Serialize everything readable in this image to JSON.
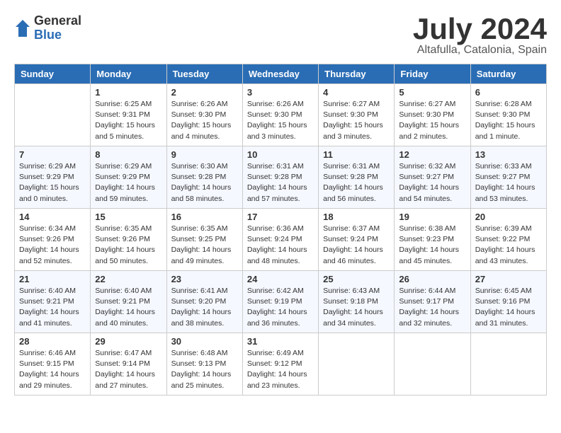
{
  "logo": {
    "general": "General",
    "blue": "Blue"
  },
  "header": {
    "month": "July 2024",
    "location": "Altafulla, Catalonia, Spain"
  },
  "weekdays": [
    "Sunday",
    "Monday",
    "Tuesday",
    "Wednesday",
    "Thursday",
    "Friday",
    "Saturday"
  ],
  "weeks": [
    [
      {
        "day": "",
        "sunrise": "",
        "sunset": "",
        "daylight": ""
      },
      {
        "day": "1",
        "sunrise": "Sunrise: 6:25 AM",
        "sunset": "Sunset: 9:31 PM",
        "daylight": "Daylight: 15 hours and 5 minutes."
      },
      {
        "day": "2",
        "sunrise": "Sunrise: 6:26 AM",
        "sunset": "Sunset: 9:30 PM",
        "daylight": "Daylight: 15 hours and 4 minutes."
      },
      {
        "day": "3",
        "sunrise": "Sunrise: 6:26 AM",
        "sunset": "Sunset: 9:30 PM",
        "daylight": "Daylight: 15 hours and 3 minutes."
      },
      {
        "day": "4",
        "sunrise": "Sunrise: 6:27 AM",
        "sunset": "Sunset: 9:30 PM",
        "daylight": "Daylight: 15 hours and 3 minutes."
      },
      {
        "day": "5",
        "sunrise": "Sunrise: 6:27 AM",
        "sunset": "Sunset: 9:30 PM",
        "daylight": "Daylight: 15 hours and 2 minutes."
      },
      {
        "day": "6",
        "sunrise": "Sunrise: 6:28 AM",
        "sunset": "Sunset: 9:30 PM",
        "daylight": "Daylight: 15 hours and 1 minute."
      }
    ],
    [
      {
        "day": "7",
        "sunrise": "Sunrise: 6:29 AM",
        "sunset": "Sunset: 9:29 PM",
        "daylight": "Daylight: 15 hours and 0 minutes."
      },
      {
        "day": "8",
        "sunrise": "Sunrise: 6:29 AM",
        "sunset": "Sunset: 9:29 PM",
        "daylight": "Daylight: 14 hours and 59 minutes."
      },
      {
        "day": "9",
        "sunrise": "Sunrise: 6:30 AM",
        "sunset": "Sunset: 9:28 PM",
        "daylight": "Daylight: 14 hours and 58 minutes."
      },
      {
        "day": "10",
        "sunrise": "Sunrise: 6:31 AM",
        "sunset": "Sunset: 9:28 PM",
        "daylight": "Daylight: 14 hours and 57 minutes."
      },
      {
        "day": "11",
        "sunrise": "Sunrise: 6:31 AM",
        "sunset": "Sunset: 9:28 PM",
        "daylight": "Daylight: 14 hours and 56 minutes."
      },
      {
        "day": "12",
        "sunrise": "Sunrise: 6:32 AM",
        "sunset": "Sunset: 9:27 PM",
        "daylight": "Daylight: 14 hours and 54 minutes."
      },
      {
        "day": "13",
        "sunrise": "Sunrise: 6:33 AM",
        "sunset": "Sunset: 9:27 PM",
        "daylight": "Daylight: 14 hours and 53 minutes."
      }
    ],
    [
      {
        "day": "14",
        "sunrise": "Sunrise: 6:34 AM",
        "sunset": "Sunset: 9:26 PM",
        "daylight": "Daylight: 14 hours and 52 minutes."
      },
      {
        "day": "15",
        "sunrise": "Sunrise: 6:35 AM",
        "sunset": "Sunset: 9:26 PM",
        "daylight": "Daylight: 14 hours and 50 minutes."
      },
      {
        "day": "16",
        "sunrise": "Sunrise: 6:35 AM",
        "sunset": "Sunset: 9:25 PM",
        "daylight": "Daylight: 14 hours and 49 minutes."
      },
      {
        "day": "17",
        "sunrise": "Sunrise: 6:36 AM",
        "sunset": "Sunset: 9:24 PM",
        "daylight": "Daylight: 14 hours and 48 minutes."
      },
      {
        "day": "18",
        "sunrise": "Sunrise: 6:37 AM",
        "sunset": "Sunset: 9:24 PM",
        "daylight": "Daylight: 14 hours and 46 minutes."
      },
      {
        "day": "19",
        "sunrise": "Sunrise: 6:38 AM",
        "sunset": "Sunset: 9:23 PM",
        "daylight": "Daylight: 14 hours and 45 minutes."
      },
      {
        "day": "20",
        "sunrise": "Sunrise: 6:39 AM",
        "sunset": "Sunset: 9:22 PM",
        "daylight": "Daylight: 14 hours and 43 minutes."
      }
    ],
    [
      {
        "day": "21",
        "sunrise": "Sunrise: 6:40 AM",
        "sunset": "Sunset: 9:21 PM",
        "daylight": "Daylight: 14 hours and 41 minutes."
      },
      {
        "day": "22",
        "sunrise": "Sunrise: 6:40 AM",
        "sunset": "Sunset: 9:21 PM",
        "daylight": "Daylight: 14 hours and 40 minutes."
      },
      {
        "day": "23",
        "sunrise": "Sunrise: 6:41 AM",
        "sunset": "Sunset: 9:20 PM",
        "daylight": "Daylight: 14 hours and 38 minutes."
      },
      {
        "day": "24",
        "sunrise": "Sunrise: 6:42 AM",
        "sunset": "Sunset: 9:19 PM",
        "daylight": "Daylight: 14 hours and 36 minutes."
      },
      {
        "day": "25",
        "sunrise": "Sunrise: 6:43 AM",
        "sunset": "Sunset: 9:18 PM",
        "daylight": "Daylight: 14 hours and 34 minutes."
      },
      {
        "day": "26",
        "sunrise": "Sunrise: 6:44 AM",
        "sunset": "Sunset: 9:17 PM",
        "daylight": "Daylight: 14 hours and 32 minutes."
      },
      {
        "day": "27",
        "sunrise": "Sunrise: 6:45 AM",
        "sunset": "Sunset: 9:16 PM",
        "daylight": "Daylight: 14 hours and 31 minutes."
      }
    ],
    [
      {
        "day": "28",
        "sunrise": "Sunrise: 6:46 AM",
        "sunset": "Sunset: 9:15 PM",
        "daylight": "Daylight: 14 hours and 29 minutes."
      },
      {
        "day": "29",
        "sunrise": "Sunrise: 6:47 AM",
        "sunset": "Sunset: 9:14 PM",
        "daylight": "Daylight: 14 hours and 27 minutes."
      },
      {
        "day": "30",
        "sunrise": "Sunrise: 6:48 AM",
        "sunset": "Sunset: 9:13 PM",
        "daylight": "Daylight: 14 hours and 25 minutes."
      },
      {
        "day": "31",
        "sunrise": "Sunrise: 6:49 AM",
        "sunset": "Sunset: 9:12 PM",
        "daylight": "Daylight: 14 hours and 23 minutes."
      },
      {
        "day": "",
        "sunrise": "",
        "sunset": "",
        "daylight": ""
      },
      {
        "day": "",
        "sunrise": "",
        "sunset": "",
        "daylight": ""
      },
      {
        "day": "",
        "sunrise": "",
        "sunset": "",
        "daylight": ""
      }
    ]
  ]
}
